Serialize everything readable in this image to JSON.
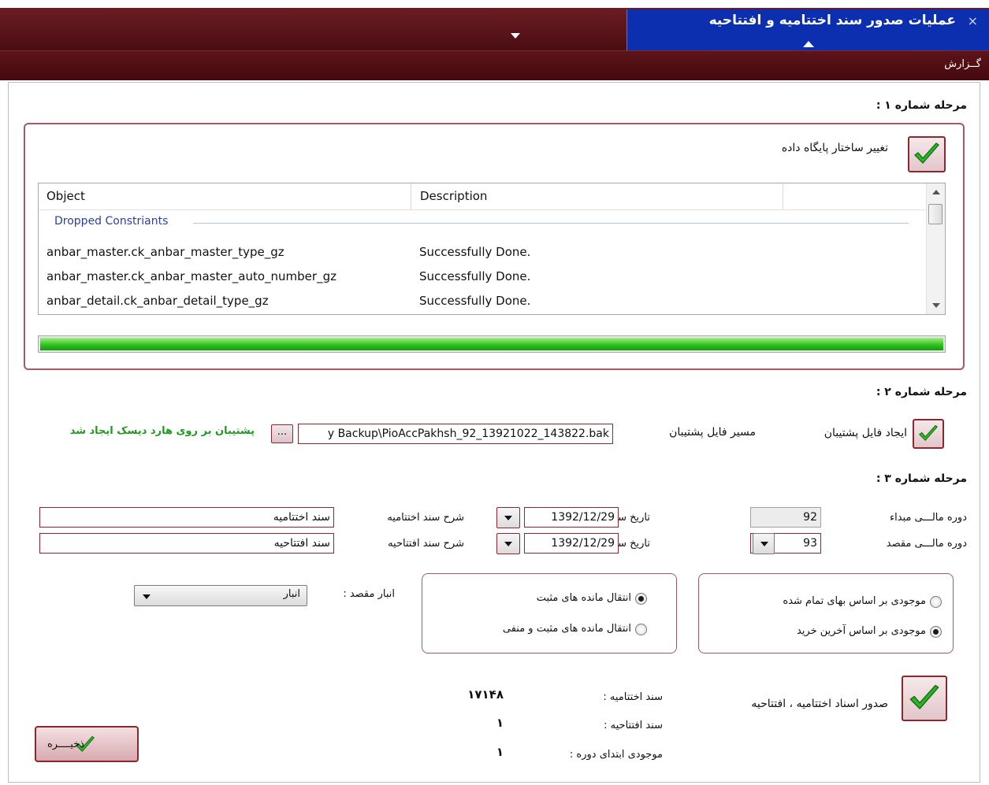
{
  "window": {
    "tab_title": "عملیات صدور سند اختتامیه و افتتاحیه",
    "close_glyph": "×",
    "menu_report": "گــزارش"
  },
  "stage1": {
    "title": "مرحله شماره ۱ :",
    "checkbox_label": "تغییر ساختار پایگاه داده",
    "list": {
      "columns": [
        "Object",
        "Description"
      ],
      "group": "Dropped Constriants",
      "rows": [
        {
          "object": "anbar_master.ck_anbar_master_type_gz",
          "description": "Successfully Done."
        },
        {
          "object": "anbar_master.ck_anbar_master_auto_number_gz",
          "description": "Successfully Done."
        },
        {
          "object": "anbar_detail.ck_anbar_detail_type_gz",
          "description": "Successfully Done."
        }
      ]
    },
    "progress_fraction": 1.0
  },
  "stage2": {
    "title": "مرحله شماره ۲ :",
    "checkbox_label": "ایجاد فایل پشتیبان",
    "path_label": "مسیر فایل پشتیبان",
    "path_value": "y Backup\\PioAccPakhsh_92_13921022_143822.bak",
    "browse_label": "...",
    "status": "پشتیبان بر روی هارد دیسک ایجاد شد"
  },
  "stage3": {
    "title": "مرحله شماره ۳ :",
    "source_period_label": "دوره مالـــی مبداء",
    "source_period_value": "92",
    "target_period_label": "دوره مالـــی مقصد",
    "target_period_value": "93",
    "closing_date_label": "تاریخ سند اختتامیه",
    "closing_date_value": "1392/12/29",
    "opening_date_label": "تاریخ سند افتتاحیه",
    "opening_date_value": "1392/12/29",
    "closing_desc_label": "شرح سند اختتامیه",
    "closing_desc_value": "سند اختتامیه",
    "opening_desc_label": "شرح سند افتتاحیه",
    "opening_desc_value": "سند افتتاحیه",
    "inventory_options": [
      "موجودی بر اساس بهای تمام شده",
      "موجودی بر اساس آخرین خرید"
    ],
    "inventory_selected": 1,
    "transfer_options": [
      "انتقال مانده های مثبت",
      "انتقال مانده های مثبت و منفی"
    ],
    "transfer_selected": 0,
    "warehouse_label": "انبار مقصد :",
    "warehouse_value": "انبار",
    "issue_label": "صدور اسناد اختتامیه ، افتتاحیه",
    "closing_doc_label": "سند اختتامیه :",
    "closing_doc_value": "۱۷۱۴۸",
    "opening_doc_label": "سند افتتاحیه :",
    "opening_doc_value": "۱",
    "initial_stock_label": "موجودی ابتدای دوره :",
    "initial_stock_value": "۱",
    "save_label": "ذخیــــره"
  },
  "colors": {
    "titlebar": "#5a1419",
    "active_tab": "#0c2fb0",
    "accent_border": "#8a2830",
    "success_text": "#1f9a1f",
    "progress": "#2fc41d"
  }
}
